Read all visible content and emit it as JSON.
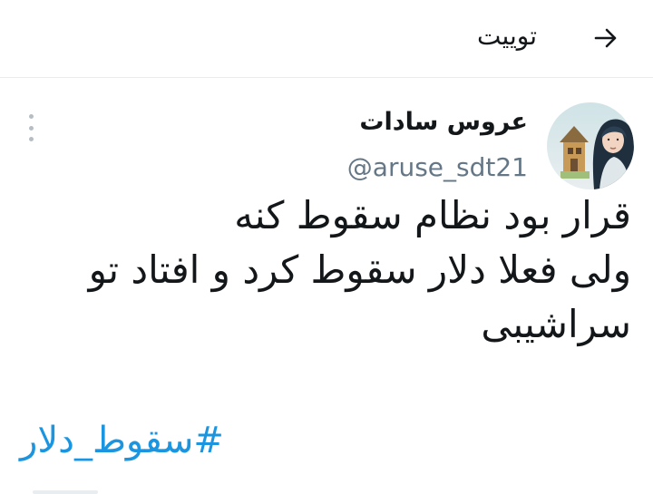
{
  "header": {
    "title": "توییت",
    "back_icon": "arrow-right-icon"
  },
  "tweet": {
    "author": {
      "display_name": "عروس سادات",
      "handle": "@aruse_sdt21"
    },
    "menu_icon": "more-vertical-icon",
    "text_lines": [
      "قرار بود نظام سقوط کنه",
      "ولی فعلا دلار سقوط کرد و افتاد تو",
      "سراشیبی"
    ],
    "hashtag": "#سقوط_دلار"
  },
  "colors": {
    "text": "#14171a",
    "secondary": "#657786",
    "link": "#1b95e0",
    "divider": "#e6ecf0"
  }
}
